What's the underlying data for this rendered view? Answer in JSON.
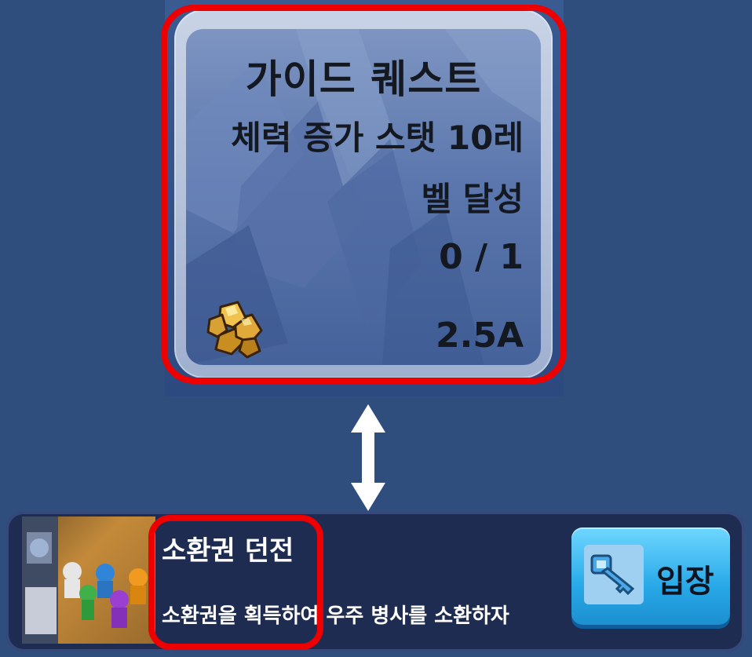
{
  "quest": {
    "title": "가이드 퀘스트",
    "description_line1": "체력 증가 스탯 10레",
    "description_line2": "벨 달성",
    "progress": "0 / 1",
    "reward_amount": "2.5A",
    "reward_icon": "gold-ore-icon"
  },
  "dungeon": {
    "title": "소환권 던전",
    "description": "소환권을 획득하여 우주 병사를 소환하자",
    "enter_label": "입장",
    "enter_icon": "key-icon"
  },
  "colors": {
    "background": "#2f4e7d",
    "highlight": "#ee0000",
    "panel": "#1f2c52",
    "button": "#28a9e8"
  }
}
